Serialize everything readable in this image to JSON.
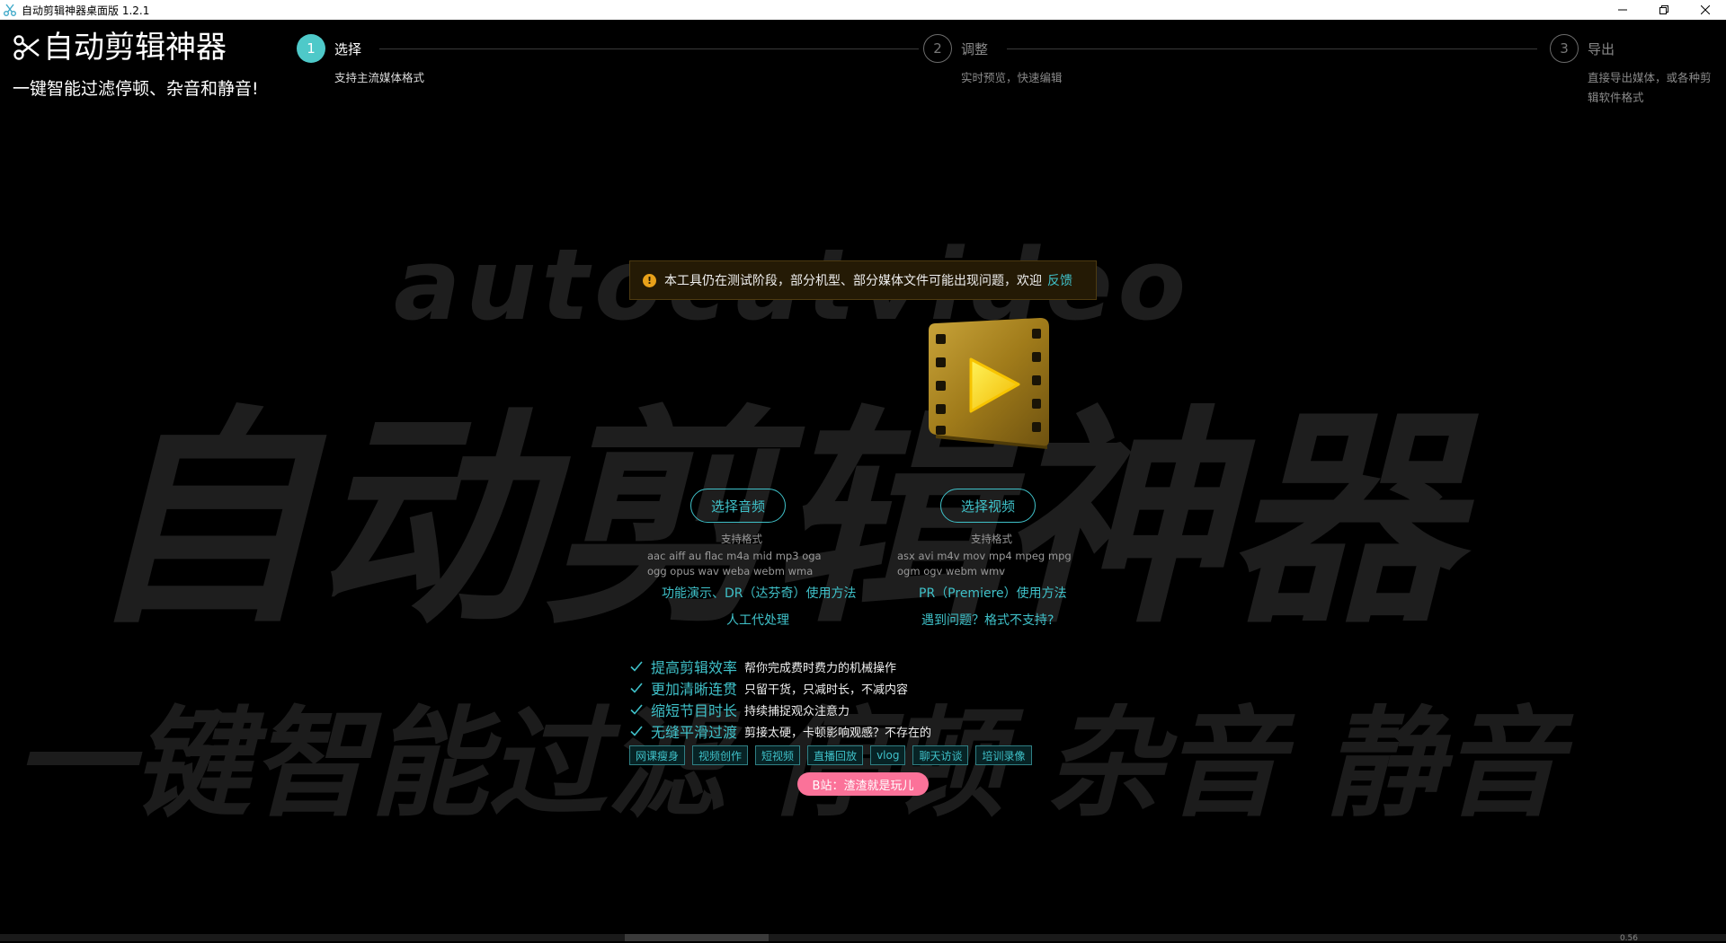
{
  "window": {
    "title": "自动剪辑神器桌面版 1.2.1"
  },
  "background": {
    "latin": "autocutvideo",
    "big": "自动剪辑神器",
    "line3": "一键智能过滤 停顿  杂音  静音"
  },
  "brand": {
    "title": "自动剪辑神器",
    "subtitle": "一键智能过滤停顿、杂音和静音!"
  },
  "steps": [
    {
      "num": "1",
      "label": "选择",
      "desc": "支持主流媒体格式",
      "active": true
    },
    {
      "num": "2",
      "label": "调整",
      "desc": "实时预览，快速编辑",
      "active": false
    },
    {
      "num": "3",
      "label": "导出",
      "desc": "直接导出媒体，或各种剪辑软件格式",
      "active": false
    }
  ],
  "warning": {
    "text": "本工具仍在测试阶段，部分机型、部分媒体文件可能出现问题，欢迎",
    "link": "反馈"
  },
  "audio": {
    "button": "选择音频",
    "formats_title": "支持格式",
    "formats_line1": "aac aiff au flac m4a mid mp3 oga",
    "formats_line2": "ogg opus wav weba webm wma"
  },
  "video": {
    "button": "选择视频",
    "formats_title": "支持格式",
    "formats_line1": "asx avi m4v mov mp4 mpeg mpg",
    "formats_line2": "ogm ogv webm wmv"
  },
  "links": {
    "demo": "功能演示、DR（达芬奇）使用方法",
    "pr": "PR（Premiere）使用方法",
    "manual": "人工代处理",
    "help": "遇到问题？格式不支持?"
  },
  "features": [
    {
      "title": "提高剪辑效率",
      "desc": "帮你完成费时费力的机械操作"
    },
    {
      "title": "更加清晰连贯",
      "desc": "只留干货，只减时长，不减内容"
    },
    {
      "title": "缩短节目时长",
      "desc": "持续捕捉观众注意力"
    },
    {
      "title": "无缝平滑过渡",
      "desc": "剪接太硬，卡顿影响观感？不存在的"
    }
  ],
  "tags": [
    "网课瘦身",
    "视频创作",
    "短视频",
    "直播回放",
    "vlog",
    "聊天访谈",
    "培训录像"
  ],
  "bilibili": "B站：渣渣就是玩儿",
  "corner": "0.56",
  "colors": {
    "accent": "#3fc1c9",
    "warning": "#e8a11a",
    "bilibili": "#fb7299"
  }
}
